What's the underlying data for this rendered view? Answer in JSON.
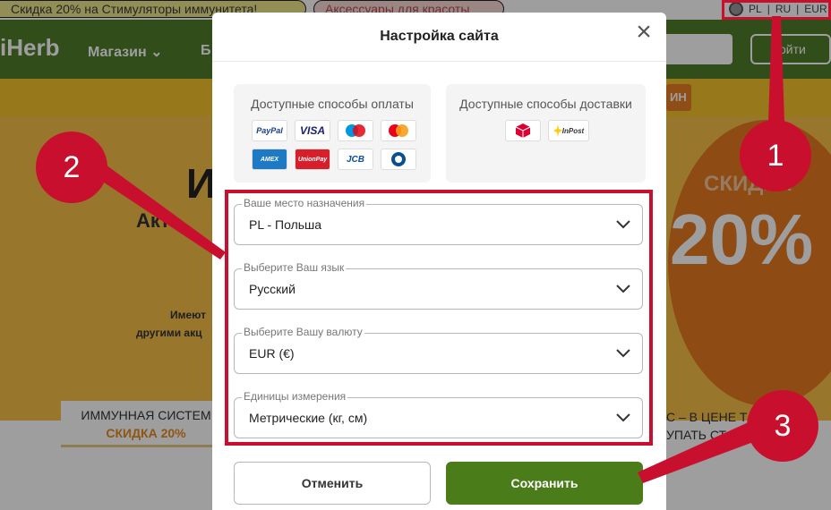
{
  "background": {
    "promo_left": "Скидка 20% на Стимуляторы иммунитета!",
    "promo_right": "Аксессуары для красоты",
    "locale": {
      "country": "PL",
      "language": "RU",
      "currency": "EUR"
    },
    "logo": "iHerb",
    "nav_shop": "Магазин ⌄",
    "nav_more": "Б",
    "login_label": "ойти",
    "ybar_btn": "ИН",
    "hero_big": "И",
    "hero_sub": "Акт",
    "hero_text1": "Имеют",
    "hero_text2": "другими акц",
    "circle_sale": "СКИДКА",
    "circle_percent": "20%",
    "tab_left_title": "ИММУННАЯ СИСТЕМ",
    "tab_left_sub": "СКИДКА 20%",
    "tab_right_line1": "С – В ЦЕНЕ Т",
    "tab_right_line2": "УПАТЬ СТ"
  },
  "modal": {
    "title": "Настройка сайта",
    "close_label": "×",
    "payment_title": "Доступные способы оплаты",
    "delivery_title": "Доступные способы доставки",
    "payment_logos": [
      "PayPal",
      "VISA",
      "Maestro",
      "MC",
      "AMEX",
      "UnionPay",
      "JCB",
      "Diners"
    ],
    "delivery_logos": [
      "DPD",
      "InPost"
    ],
    "fields": [
      {
        "label": "Ваше место назначения",
        "value": "PL - Польша"
      },
      {
        "label": "Выберите Ваш язык",
        "value": "Русский"
      },
      {
        "label": "Выберите Вашу валюту",
        "value": "EUR (€)"
      },
      {
        "label": "Единицы измерения",
        "value": "Метрические (кг, см)"
      }
    ],
    "cancel_label": "Отменить",
    "save_label": "Сохранить"
  },
  "annotations": {
    "badge1": "1",
    "badge2": "2",
    "badge3": "3",
    "color": "#c8102e"
  }
}
